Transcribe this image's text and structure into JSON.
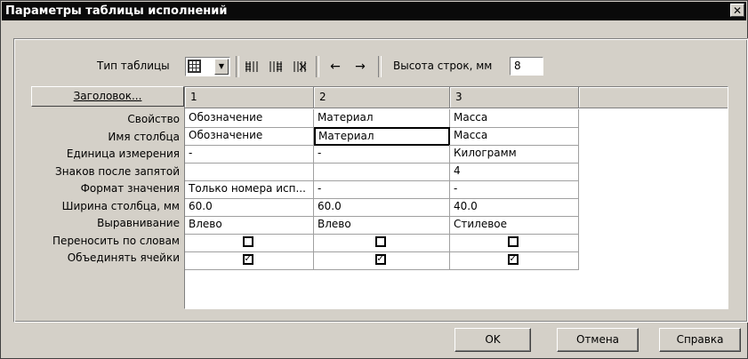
{
  "window": {
    "title": "Параметры таблицы исполнений",
    "close_label": "✕"
  },
  "toolbar": {
    "table_type_label": "Тип таблицы",
    "row_height_label": "Высота строк, мм",
    "row_height_value": "8",
    "arrow_left": "←",
    "arrow_right": "→",
    "icons": [
      "table-grid-icon",
      "insert-column-icon",
      "insert-column-after-icon",
      "delete-column-icon",
      "move-left-icon",
      "move-right-icon"
    ]
  },
  "header_button": "Заголовок...",
  "row_labels": [
    "Свойство",
    "Имя столбца",
    "Единица измерения",
    "Знаков после запятой",
    "Формат значения",
    "Ширина столбца, мм",
    "Выравнивание",
    "Переносить по словам",
    "Объединять ячейки"
  ],
  "columns": [
    {
      "header": "1",
      "cells": [
        "Обозначение",
        "Обозначение",
        "-",
        "",
        "Только номера исп...",
        "60.0",
        "Влево"
      ],
      "wrap": false,
      "merge": true
    },
    {
      "header": "2",
      "cells": [
        "Материал",
        "Материал",
        "-",
        "",
        "-",
        "60.0",
        "Влево"
      ],
      "wrap": false,
      "merge": true
    },
    {
      "header": "3",
      "cells": [
        "Масса",
        "Масса",
        "Килограмм",
        "4",
        "-",
        "40.0",
        "Стилевое"
      ],
      "wrap": false,
      "merge": true
    }
  ],
  "buttons": {
    "ok": "OK",
    "cancel": "Отмена",
    "help": "Справка"
  }
}
